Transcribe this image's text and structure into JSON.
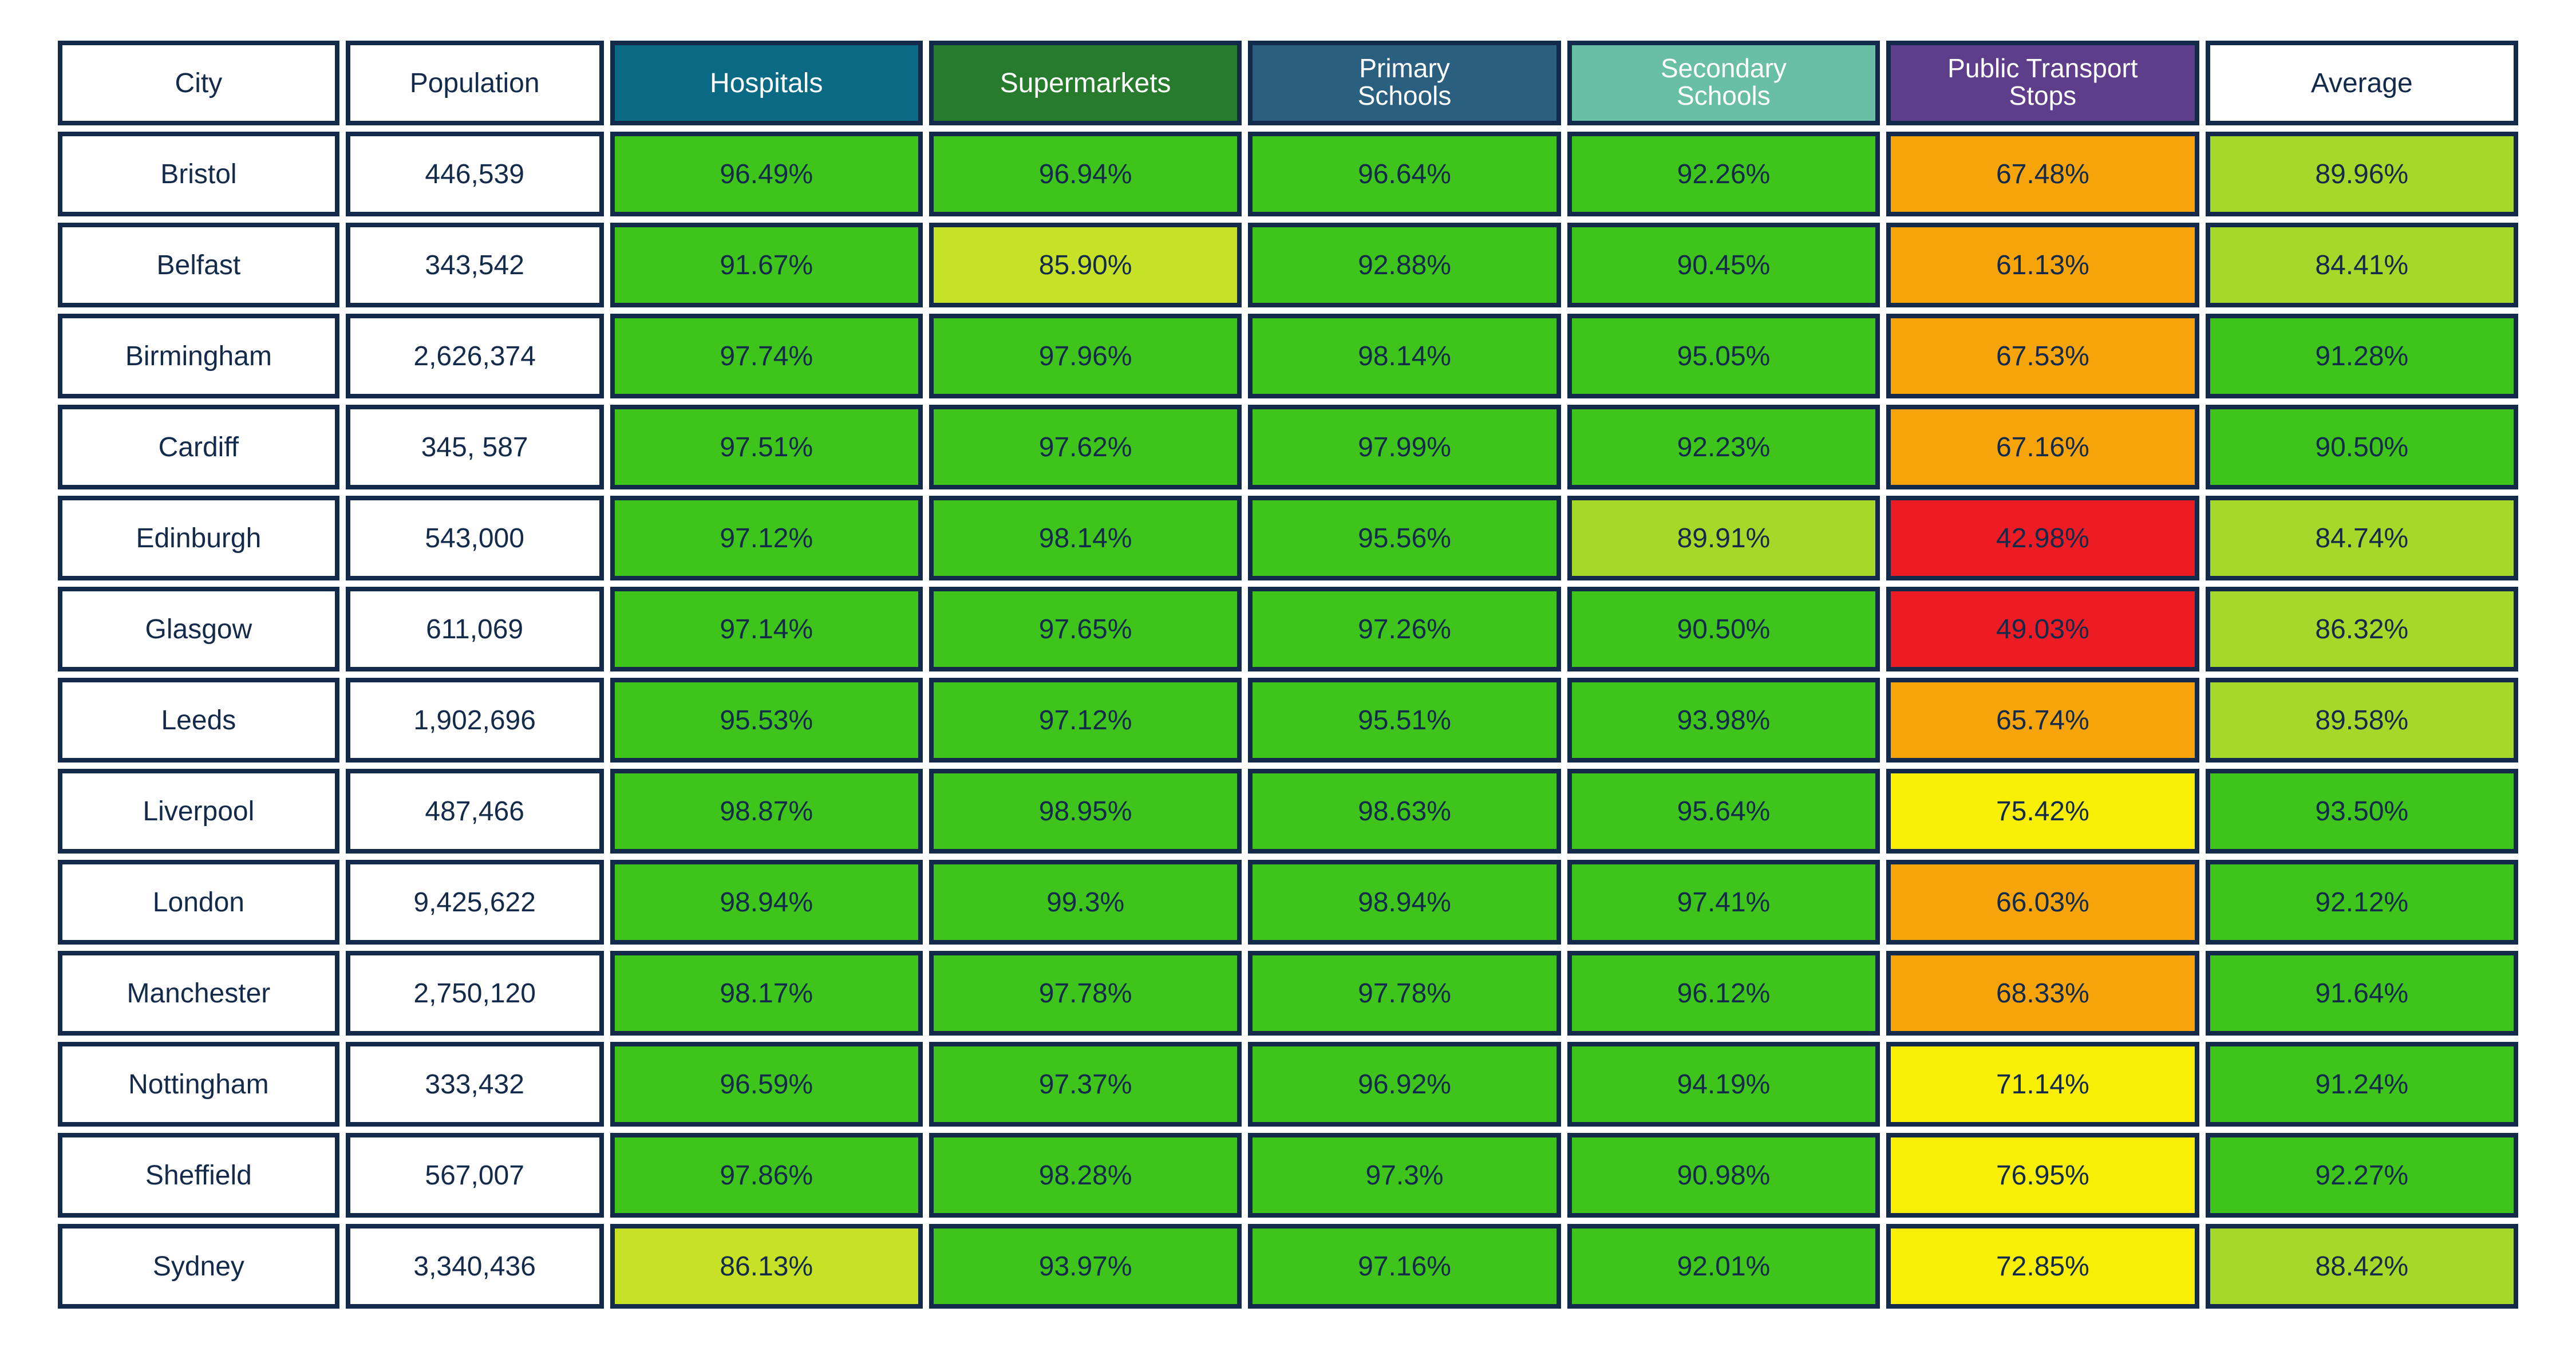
{
  "headers": {
    "city": "City",
    "population": "Population",
    "hospitals": "Hospitals",
    "supermarkets": "Supermarkets",
    "primary_schools": "Primary\nSchools",
    "secondary_schools": "Secondary\nSchools",
    "public_transport_stops": "Public Transport\nStops",
    "average": "Average"
  },
  "heat_colors": {
    "green": "#3ec41b",
    "ygreen": "#a5d929",
    "lime": "#c7e126",
    "yellow": "#f9ef04",
    "orange": "#f6a409",
    "red": "#ed1c24"
  },
  "chart_data": {
    "type": "table",
    "title": "",
    "columns": [
      "City",
      "Population",
      "Hospitals",
      "Supermarkets",
      "Primary Schools",
      "Secondary Schools",
      "Public Transport Stops",
      "Average"
    ],
    "rows": [
      {
        "city": "Bristol",
        "population": "446,539",
        "hospitals": {
          "v": "96.49%",
          "c": "green"
        },
        "supermarkets": {
          "v": "96.94%",
          "c": "green"
        },
        "primary": {
          "v": "96.64%",
          "c": "green"
        },
        "secondary": {
          "v": "92.26%",
          "c": "green"
        },
        "pts": {
          "v": "67.48%",
          "c": "orange"
        },
        "avg": {
          "v": "89.96%",
          "c": "ygreen"
        }
      },
      {
        "city": "Belfast",
        "population": "343,542",
        "hospitals": {
          "v": "91.67%",
          "c": "green"
        },
        "supermarkets": {
          "v": "85.90%",
          "c": "lime"
        },
        "primary": {
          "v": "92.88%",
          "c": "green"
        },
        "secondary": {
          "v": "90.45%",
          "c": "green"
        },
        "pts": {
          "v": "61.13%",
          "c": "orange"
        },
        "avg": {
          "v": "84.41%",
          "c": "ygreen"
        }
      },
      {
        "city": "Birmingham",
        "population": "2,626,374",
        "hospitals": {
          "v": "97.74%",
          "c": "green"
        },
        "supermarkets": {
          "v": "97.96%",
          "c": "green"
        },
        "primary": {
          "v": "98.14%",
          "c": "green"
        },
        "secondary": {
          "v": "95.05%",
          "c": "green"
        },
        "pts": {
          "v": "67.53%",
          "c": "orange"
        },
        "avg": {
          "v": "91.28%",
          "c": "green"
        }
      },
      {
        "city": "Cardiff",
        "population": "345, 587",
        "hospitals": {
          "v": "97.51%",
          "c": "green"
        },
        "supermarkets": {
          "v": "97.62%",
          "c": "green"
        },
        "primary": {
          "v": "97.99%",
          "c": "green"
        },
        "secondary": {
          "v": "92.23%",
          "c": "green"
        },
        "pts": {
          "v": "67.16%",
          "c": "orange"
        },
        "avg": {
          "v": "90.50%",
          "c": "green"
        }
      },
      {
        "city": "Edinburgh",
        "population": "543,000",
        "hospitals": {
          "v": "97.12%",
          "c": "green"
        },
        "supermarkets": {
          "v": "98.14%",
          "c": "green"
        },
        "primary": {
          "v": "95.56%",
          "c": "green"
        },
        "secondary": {
          "v": "89.91%",
          "c": "ygreen"
        },
        "pts": {
          "v": "42.98%",
          "c": "red"
        },
        "avg": {
          "v": "84.74%",
          "c": "ygreen"
        }
      },
      {
        "city": "Glasgow",
        "population": "611,069",
        "hospitals": {
          "v": "97.14%",
          "c": "green"
        },
        "supermarkets": {
          "v": "97.65%",
          "c": "green"
        },
        "primary": {
          "v": "97.26%",
          "c": "green"
        },
        "secondary": {
          "v": "90.50%",
          "c": "green"
        },
        "pts": {
          "v": "49.03%",
          "c": "red"
        },
        "avg": {
          "v": "86.32%",
          "c": "ygreen"
        }
      },
      {
        "city": "Leeds",
        "population": "1,902,696",
        "hospitals": {
          "v": "95.53%",
          "c": "green"
        },
        "supermarkets": {
          "v": "97.12%",
          "c": "green"
        },
        "primary": {
          "v": "95.51%",
          "c": "green"
        },
        "secondary": {
          "v": "93.98%",
          "c": "green"
        },
        "pts": {
          "v": "65.74%",
          "c": "orange"
        },
        "avg": {
          "v": "89.58%",
          "c": "ygreen"
        }
      },
      {
        "city": "Liverpool",
        "population": "487,466",
        "hospitals": {
          "v": "98.87%",
          "c": "green"
        },
        "supermarkets": {
          "v": "98.95%",
          "c": "green"
        },
        "primary": {
          "v": "98.63%",
          "c": "green"
        },
        "secondary": {
          "v": "95.64%",
          "c": "green"
        },
        "pts": {
          "v": "75.42%",
          "c": "yellow"
        },
        "avg": {
          "v": "93.50%",
          "c": "green"
        }
      },
      {
        "city": "London",
        "population": "9,425,622",
        "hospitals": {
          "v": "98.94%",
          "c": "green"
        },
        "supermarkets": {
          "v": "99.3%",
          "c": "green"
        },
        "primary": {
          "v": "98.94%",
          "c": "green"
        },
        "secondary": {
          "v": "97.41%",
          "c": "green"
        },
        "pts": {
          "v": "66.03%",
          "c": "orange"
        },
        "avg": {
          "v": "92.12%",
          "c": "green"
        }
      },
      {
        "city": "Manchester",
        "population": "2,750,120",
        "hospitals": {
          "v": "98.17%",
          "c": "green"
        },
        "supermarkets": {
          "v": "97.78%",
          "c": "green"
        },
        "primary": {
          "v": "97.78%",
          "c": "green"
        },
        "secondary": {
          "v": "96.12%",
          "c": "green"
        },
        "pts": {
          "v": "68.33%",
          "c": "orange"
        },
        "avg": {
          "v": "91.64%",
          "c": "green"
        }
      },
      {
        "city": "Nottingham",
        "population": "333,432",
        "hospitals": {
          "v": "96.59%",
          "c": "green"
        },
        "supermarkets": {
          "v": "97.37%",
          "c": "green"
        },
        "primary": {
          "v": "96.92%",
          "c": "green"
        },
        "secondary": {
          "v": "94.19%",
          "c": "green"
        },
        "pts": {
          "v": "71.14%",
          "c": "yellow"
        },
        "avg": {
          "v": "91.24%",
          "c": "green"
        }
      },
      {
        "city": "Sheffield",
        "population": "567,007",
        "hospitals": {
          "v": "97.86%",
          "c": "green"
        },
        "supermarkets": {
          "v": "98.28%",
          "c": "green"
        },
        "primary": {
          "v": "97.3%",
          "c": "green"
        },
        "secondary": {
          "v": "90.98%",
          "c": "green"
        },
        "pts": {
          "v": "76.95%",
          "c": "yellow"
        },
        "avg": {
          "v": "92.27%",
          "c": "green"
        }
      },
      {
        "city": "Sydney",
        "population": "3,340,436",
        "hospitals": {
          "v": "86.13%",
          "c": "lime"
        },
        "supermarkets": {
          "v": "93.97%",
          "c": "green"
        },
        "primary": {
          "v": "97.16%",
          "c": "green"
        },
        "secondary": {
          "v": "92.01%",
          "c": "green"
        },
        "pts": {
          "v": "72.85%",
          "c": "yellow"
        },
        "avg": {
          "v": "88.42%",
          "c": "ygreen"
        }
      }
    ]
  }
}
